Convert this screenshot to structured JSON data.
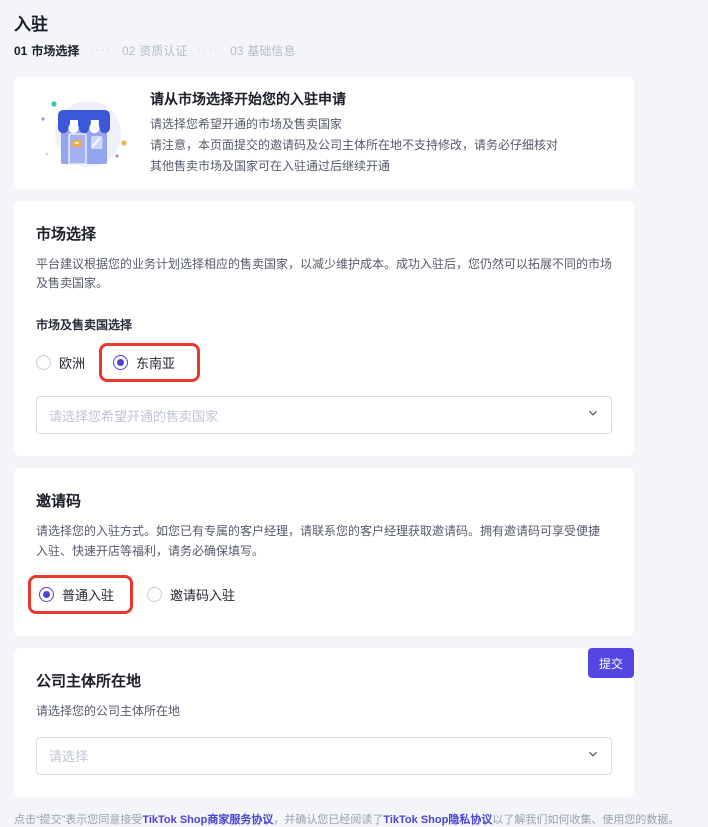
{
  "page": {
    "title": "入驻"
  },
  "steps": {
    "separator": "····",
    "items": [
      {
        "number": "01",
        "label": "市场选择",
        "active": true
      },
      {
        "number": "02",
        "label": "资质认证",
        "active": false
      },
      {
        "number": "03",
        "label": "基础信息",
        "active": false
      }
    ]
  },
  "intro_card": {
    "icon": "storefront-illustration",
    "title": "请从市场选择开始您的入驻申请",
    "lines": [
      "请选择您希望开通的市场及售卖国家",
      "请注意，本页面提交的邀请码及公司主体所在地不支持修改，请务必仔细核对",
      "其他售卖市场及国家可在入驻通过后继续开通"
    ]
  },
  "market_section": {
    "title": "市场选择",
    "description": "平台建议根据您的业务计划选择相应的售卖国家，以减少维护成本。成功入驻后，您仍然可以拓展不同的市场及售卖国家。",
    "field_label": "市场及售卖国选择",
    "options": [
      {
        "label": "欧洲",
        "selected": false
      },
      {
        "label": "东南亚",
        "selected": true,
        "annotated": true
      }
    ],
    "country_select_placeholder": "请选择您希望开通的售卖国家"
  },
  "invite_section": {
    "title": "邀请码",
    "description": "请选择您的入驻方式。如您已有专属的客户经理，请联系您的客户经理获取邀请码。拥有邀请码可享受便捷入驻、快速开店等福利，请务必确保填写。",
    "options": [
      {
        "label": "普通入驻",
        "selected": true,
        "annotated": true
      },
      {
        "label": "邀请码入驻",
        "selected": false
      }
    ]
  },
  "company_section": {
    "title": "公司主体所在地",
    "description": "请选择您的公司主体所在地",
    "select_placeholder": "请选择"
  },
  "footer": {
    "agreement_prefix": "点击“提交”表示您同意接受",
    "service_agreement_link": "TikTok Shop商家服务协议",
    "agreement_middle": "，并确认您已经阅读了",
    "privacy_link": "TikTok Shop隐私协议",
    "agreement_suffix": "以了解我们如何收集、使用您的数据。",
    "submit_label": "提交"
  },
  "colors": {
    "accent_purple": "#4c40dd",
    "annotation_red": "#e8392e",
    "page_background": "#f4f5f9",
    "link_purple": "#4b44d4"
  }
}
